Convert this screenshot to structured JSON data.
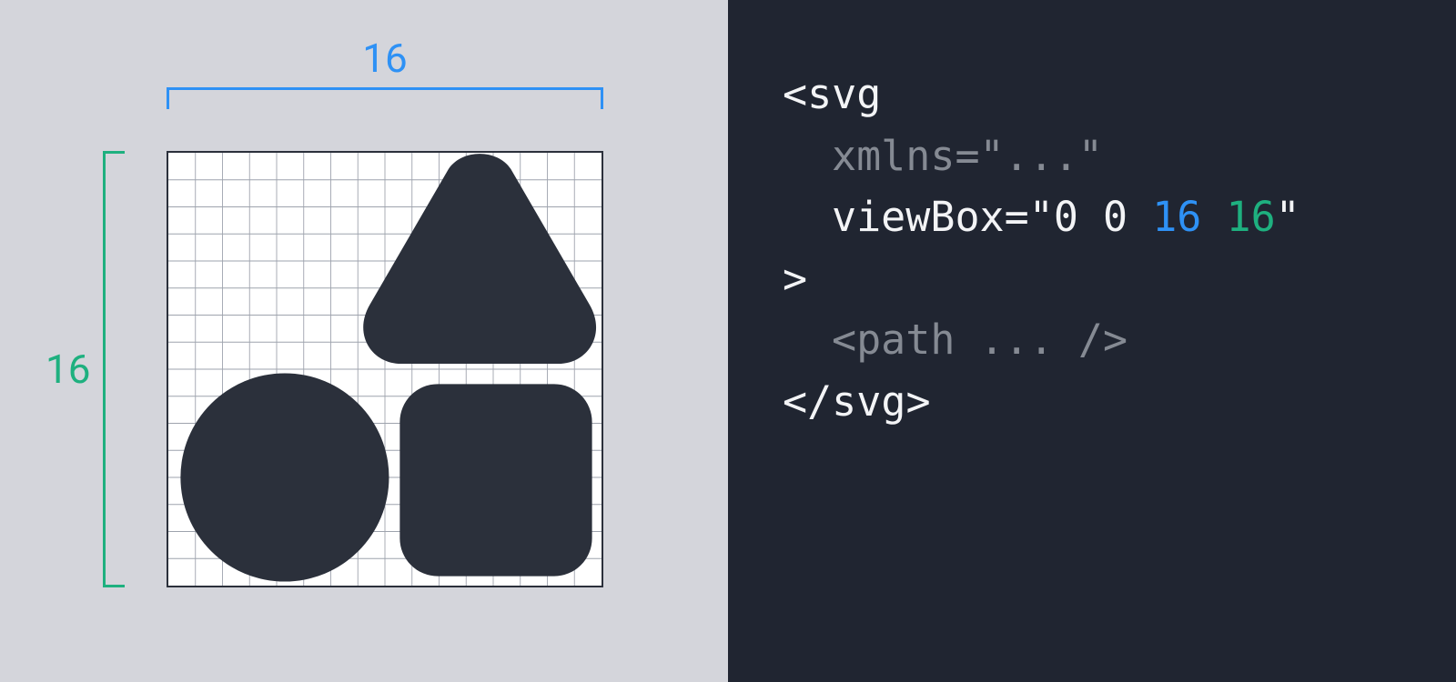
{
  "dimensions": {
    "width_label": "16",
    "height_label": "16"
  },
  "code": {
    "l1": "<svg",
    "l2_attr": "xmlns",
    "l2_eq": "=\"...\"",
    "l3_attr": "viewBox=\"0 0 ",
    "l3_w": "16",
    "l3_sp": " ",
    "l3_h": "16",
    "l3_end": "\"",
    "l4": ">",
    "l5": "<path ... />",
    "l6": "</svg>"
  },
  "colors": {
    "width_accent": "#2e91f5",
    "height_accent": "#1eb07f",
    "shape_fill": "#2b303b",
    "left_bg": "#d4d5db",
    "right_bg": "#202531"
  },
  "grid": {
    "cells": 16
  }
}
